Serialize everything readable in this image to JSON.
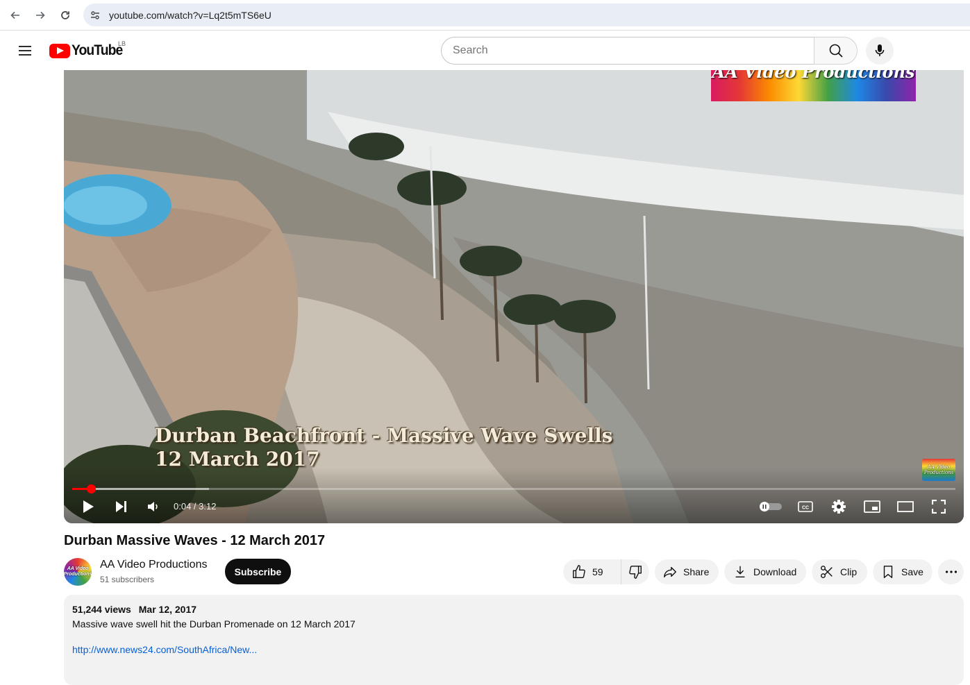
{
  "browser": {
    "url": "youtube.com/watch?v=Lq2t5mTS6eU"
  },
  "header": {
    "logo_text": "YouTube",
    "country_code": "LB",
    "search_placeholder": "Search"
  },
  "player": {
    "overlay_caption_line1": "Durban Beachfront - Massive Wave Swells",
    "overlay_caption_line2": "12 March 2017",
    "watermark_banner": "AA Video Productions",
    "corner_logo": "AA Video Productions",
    "current_time": "0:04",
    "duration": "3:12",
    "time_display": "0:04 / 3:12",
    "progress_fraction": 0.021,
    "buffered_fraction": 0.155
  },
  "video": {
    "title": "Durban Massive Waves - 12 March 2017"
  },
  "channel": {
    "name": "AA Video Productions",
    "avatar_text": "AA Video Productions",
    "subscribers": "51 subscribers",
    "subscribe_label": "Subscribe"
  },
  "actions": {
    "like_count": "59",
    "share_label": "Share",
    "download_label": "Download",
    "clip_label": "Clip",
    "save_label": "Save"
  },
  "description": {
    "views": "51,244 views",
    "date": "Mar 12, 2017",
    "text": "Massive wave swell hit the Durban Promenade on 12 March 2017",
    "link": "http://www.news24.com/SouthAfrica/New..."
  },
  "colors": {
    "brand_red": "#ff0000",
    "link_blue": "#065fd4",
    "pill_bg": "#f2f2f2"
  }
}
